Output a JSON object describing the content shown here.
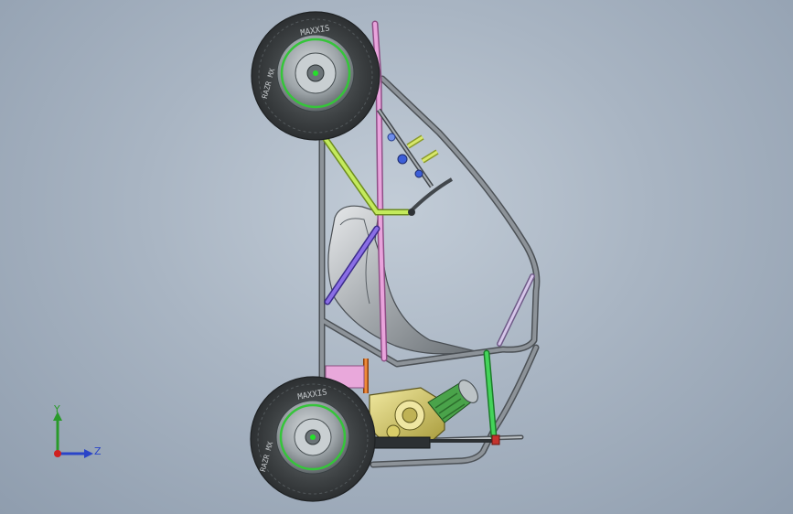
{
  "viewport": {
    "background_top": "#c2ccd7",
    "background_bottom": "#8f9dae"
  },
  "model": {
    "tire_text": "MAXXIS",
    "tire_side_text": "RAZR MX",
    "colors": {
      "frame_tube": "#6f757b",
      "tire": "#3a3d3f",
      "rim": "#9aa2a6",
      "rim_highlight": "#39c03a",
      "lime_member": "#b8e04a",
      "pink_member": "#e38fd6",
      "violet_member": "#7b5bd6",
      "green_member": "#35c34a",
      "orange_member": "#e27a2a",
      "engine_body": "#d9cf6a",
      "engine_filter": "#4aa34a",
      "seat": "#b9bcc0",
      "magenta_bracket": "#e7a2d8"
    }
  },
  "triad": {
    "y_label": "Y",
    "z_label": "Z",
    "x_color": "#d02020",
    "y_color": "#2a9a2a",
    "z_color": "#2a44c8"
  }
}
